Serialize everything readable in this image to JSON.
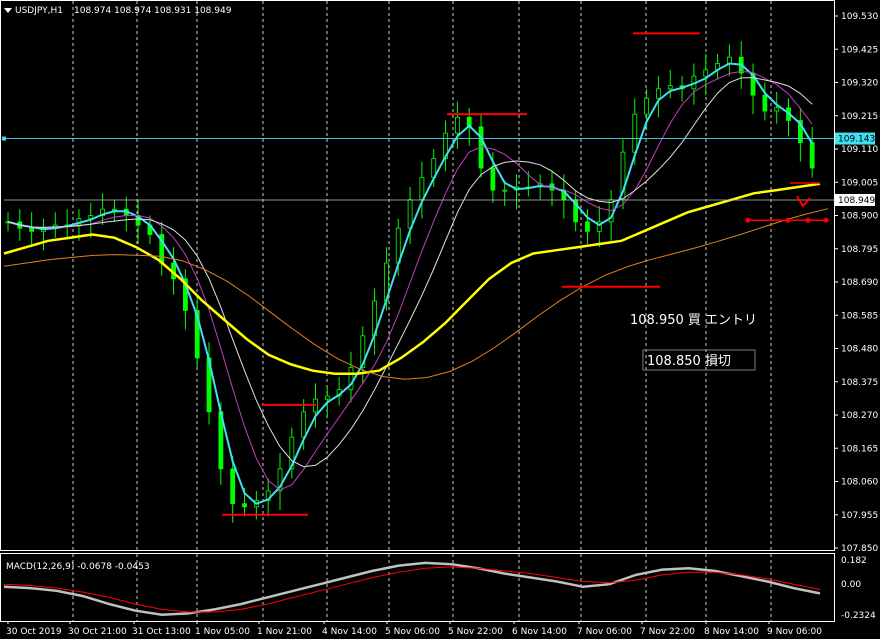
{
  "header": {
    "symbol": "USDJPY,H1",
    "ohlc": "108.974 108.974 108.931 108.949"
  },
  "indicator": {
    "label": "MACD(12,26,9) -0.0678 -0.0453",
    "scale": [
      "0.182",
      "0.00",
      "-0.2324"
    ]
  },
  "annotations": {
    "entry": "108.950  買  エントリ",
    "stop": "108.850  損切"
  },
  "colors": {
    "background": "#000000",
    "up_bar": "#00ff00",
    "fast_ma": "#40e0f0",
    "slow_ma": "#ffff00",
    "support_resistance": "#ff0000",
    "reference_line": "#40e0f0"
  },
  "chart_data": {
    "type": "line",
    "y_ticks": [
      "109.530",
      "109.425",
      "109.320",
      "109.215",
      "109.110",
      "109.005",
      "108.900",
      "108.795",
      "108.690",
      "108.585",
      "108.480",
      "108.375",
      "108.270",
      "108.165",
      "108.060",
      "107.955",
      "107.850"
    ],
    "ylim": [
      107.85,
      109.53
    ],
    "x_ticks": [
      "30 Oct 2019",
      "30 Oct 21:00",
      "31 Oct 13:00",
      "1 Nov 05:00",
      "1 Nov 21:00",
      "4 Nov 14:00",
      "5 Nov 06:00",
      "5 Nov 22:00",
      "6 Nov 14:00",
      "7 Nov 06:00",
      "7 Nov 22:00",
      "8 Nov 14:00",
      "9 Nov 06:00"
    ],
    "price_tags": {
      "level": "109.143",
      "current": "108.949"
    },
    "levels": [
      {
        "value": 109.143,
        "color": "#40e0f0"
      },
      {
        "value": 108.949,
        "color": "#c0c0c0"
      }
    ],
    "series": [
      {
        "values": [
          108.88,
          108.86,
          108.85,
          108.86,
          108.87,
          108.87,
          108.89,
          108.9,
          108.92,
          108.92,
          108.9,
          108.87,
          108.84,
          108.75,
          108.7,
          108.6,
          108.45,
          108.28,
          108.1,
          107.99,
          107.98,
          108.0,
          108.03,
          108.1,
          108.2,
          108.28,
          108.32,
          108.33,
          108.35,
          108.42,
          108.52,
          108.63,
          108.75,
          108.86,
          108.95,
          109.02,
          109.08,
          109.16,
          109.21,
          109.18,
          109.05,
          108.98,
          108.98,
          108.99,
          108.99,
          109.0,
          108.98,
          108.95,
          108.88,
          108.85,
          108.88,
          108.95,
          109.1,
          109.22,
          109.27,
          109.3,
          109.31,
          109.3,
          109.34,
          109.36,
          109.38,
          109.4,
          109.35,
          109.28,
          109.23,
          109.24,
          109.2,
          109.13,
          109.05
        ]
      },
      {
        "values": [
          108.78,
          108.8,
          108.82,
          108.83,
          108.84,
          108.83,
          108.8,
          108.76,
          108.7,
          108.63,
          108.57,
          108.51,
          108.46,
          108.43,
          108.41,
          108.4,
          108.4,
          108.41,
          108.45,
          108.5,
          108.56,
          108.63,
          108.7,
          108.75,
          108.78,
          108.79,
          108.8,
          108.81,
          108.82,
          108.85,
          108.88,
          108.91,
          108.93,
          108.95,
          108.97,
          108.98,
          108.99,
          109.0
        ]
      }
    ],
    "resistance_marks": [
      108.302,
      107.955,
      109.22,
      108.675,
      109.475
    ],
    "stop_level": 108.885,
    "macd": {
      "ylim": [
        -0.2324,
        0.182
      ],
      "main": [
        -0.02,
        -0.03,
        -0.05,
        -0.09,
        -0.15,
        -0.2,
        -0.23,
        -0.22,
        -0.19,
        -0.15,
        -0.1,
        -0.05,
        0.0,
        0.05,
        0.1,
        0.14,
        0.16,
        0.15,
        0.12,
        0.08,
        0.05,
        0.02,
        -0.02,
        0.0,
        0.07,
        0.11,
        0.12,
        0.1,
        0.06,
        0.02,
        -0.03,
        -0.07
      ],
      "signal": [
        0.0,
        -0.01,
        -0.03,
        -0.06,
        -0.1,
        -0.15,
        -0.19,
        -0.21,
        -0.21,
        -0.19,
        -0.15,
        -0.1,
        -0.05,
        0.0,
        0.05,
        0.09,
        0.12,
        0.13,
        0.12,
        0.1,
        0.08,
        0.05,
        0.02,
        0.01,
        0.03,
        0.07,
        0.09,
        0.09,
        0.07,
        0.04,
        0.0,
        -0.04
      ]
    }
  }
}
